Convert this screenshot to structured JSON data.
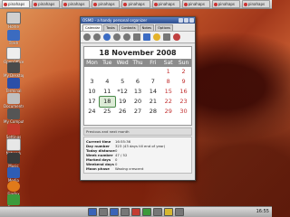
{
  "taskbar": {
    "tasks": [
      {
        "label": "pinahaps"
      },
      {
        "label": "pinahaps"
      },
      {
        "label": "pinahaps"
      },
      {
        "label": "pinahaps"
      },
      {
        "label": "pinahaps"
      },
      {
        "label": "pinahaps"
      },
      {
        "label": "pinahaps"
      },
      {
        "label": "pinahaps"
      },
      {
        "label": "pinahaps"
      }
    ]
  },
  "desktop_icons": [
    {
      "label": "Home"
    },
    {
      "label": "Trash"
    },
    {
      "label": "OpenOffice"
    },
    {
      "label": "My Desktop"
    },
    {
      "label": "Terminal"
    },
    {
      "label": "Documents"
    },
    {
      "label": "My Computer"
    },
    {
      "label": "Settings"
    },
    {
      "label": "Network"
    },
    {
      "label": "Music"
    },
    {
      "label": "Media"
    },
    {
      "label": "Firefox"
    },
    {
      "label": "Games"
    }
  ],
  "window": {
    "title": "OSMO - a handy personal organizer",
    "tabs": [
      "Calendar",
      "Tasks",
      "Contacts",
      "Notes",
      "Options"
    ]
  },
  "calendar": {
    "header": "18 November 2008",
    "weekdays": [
      "Mon",
      "Tue",
      "Wed",
      "Thu",
      "Fri",
      "Sat",
      "Sun"
    ],
    "rows": [
      [
        "",
        "",
        "",
        "",
        "",
        "1",
        "2"
      ],
      [
        "3",
        "4",
        "5",
        "6",
        "7",
        "8",
        "9"
      ],
      [
        "10",
        "11",
        "*12",
        "13",
        "14",
        "15",
        "16"
      ],
      [
        "17",
        "18",
        "19",
        "20",
        "21",
        "22",
        "23"
      ],
      [
        "24",
        "25",
        "26",
        "27",
        "28",
        "29",
        "30"
      ]
    ],
    "today": "18"
  },
  "info_section": {
    "title": "Previous and next month",
    "rows": [
      {
        "k": "Current time",
        "v": "16:55:36"
      },
      {
        "k": "Day number",
        "v": "323 (43 days till end of year)"
      },
      {
        "k": "Today distance",
        "v": "0"
      },
      {
        "k": "Week number",
        "v": "47 / 52"
      },
      {
        "k": "Marked days",
        "v": "0"
      },
      {
        "k": "Weekend days",
        "v": "0"
      },
      {
        "k": "Moon phase",
        "v": "Waxing crescent"
      }
    ]
  },
  "clock": "16:55"
}
